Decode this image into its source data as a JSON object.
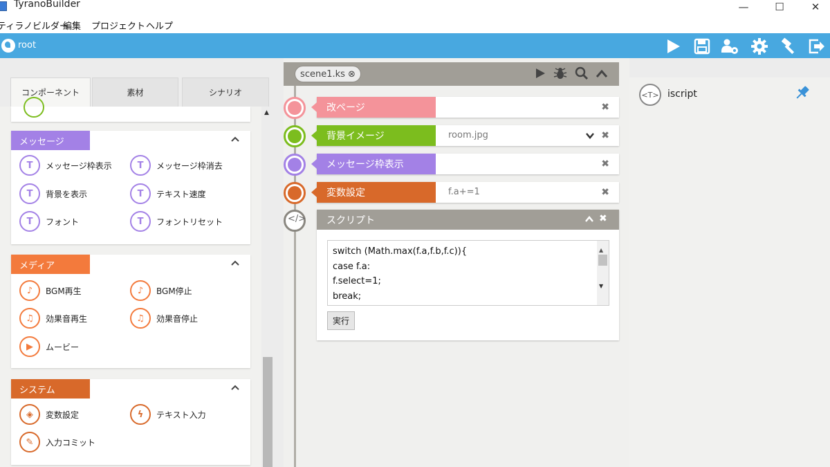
{
  "window": {
    "title": "TyranoBuilder",
    "minimize": "—",
    "maximize": "☐",
    "close": "✕"
  },
  "menu": [
    "ティラノビルダー",
    "編集",
    "プロジェクト",
    "ヘルプ"
  ],
  "toolbar": {
    "root_label": "root",
    "icons": [
      "play-icon",
      "save-icon",
      "users-settings-icon",
      "gear-icon",
      "hammer-icon",
      "exit-icon"
    ]
  },
  "left_tabs": [
    "コンポーネント",
    "素材",
    "シナリオ"
  ],
  "colors": {
    "toolbar": "#48a8e0",
    "message": "#a381e6",
    "media": "#f37a3c",
    "system": "#d8692a",
    "page_break": "#f4939a",
    "background_image": "#7cbd1e",
    "variable": "#d8692a",
    "script": "#a19e97"
  },
  "sections": [
    {
      "title": "メッセージ",
      "items": [
        {
          "label": "メッセージ枠表示",
          "icon": "message-show-icon"
        },
        {
          "label": "メッセージ枠消去",
          "icon": "message-hide-icon"
        },
        {
          "label": "背景を表示",
          "icon": "background-show-icon"
        },
        {
          "label": "テキスト速度",
          "icon": "text-speed-icon"
        },
        {
          "label": "フォント",
          "icon": "font-icon"
        },
        {
          "label": "フォントリセット",
          "icon": "font-reset-icon"
        }
      ]
    },
    {
      "title": "メディア",
      "items": [
        {
          "label": "BGM再生",
          "icon": "bgm-play-icon"
        },
        {
          "label": "BGM停止",
          "icon": "bgm-stop-icon"
        },
        {
          "label": "効果音再生",
          "icon": "se-play-icon"
        },
        {
          "label": "効果音停止",
          "icon": "se-stop-icon"
        },
        {
          "label": "ムービー",
          "icon": "movie-icon"
        }
      ]
    },
    {
      "title": "システム",
      "items": [
        {
          "label": "変数設定",
          "icon": "variable-icon"
        },
        {
          "label": "テキスト入力",
          "icon": "text-input-icon"
        },
        {
          "label": "入力コミット",
          "icon": "input-commit-icon"
        }
      ]
    }
  ],
  "scene": {
    "tab_label": "scene1.ks ⊗",
    "tags": [
      {
        "label": "改ページ",
        "value": ""
      },
      {
        "label": "背景イメージ",
        "value": "room.jpg"
      },
      {
        "label": "メッセージ枠表示",
        "value": ""
      },
      {
        "label": "変数設定",
        "value": "f.a+=1"
      }
    ],
    "script": {
      "label": "スクリプト",
      "lines": [
        "switch (Math.max(f.a,f.b,f.c)){",
        "case f.a:",
        "f.select=1;",
        "break;"
      ],
      "run_button": "実行"
    }
  },
  "right_panel": {
    "item_icon_text": "<T>",
    "item_label": "iscript"
  }
}
